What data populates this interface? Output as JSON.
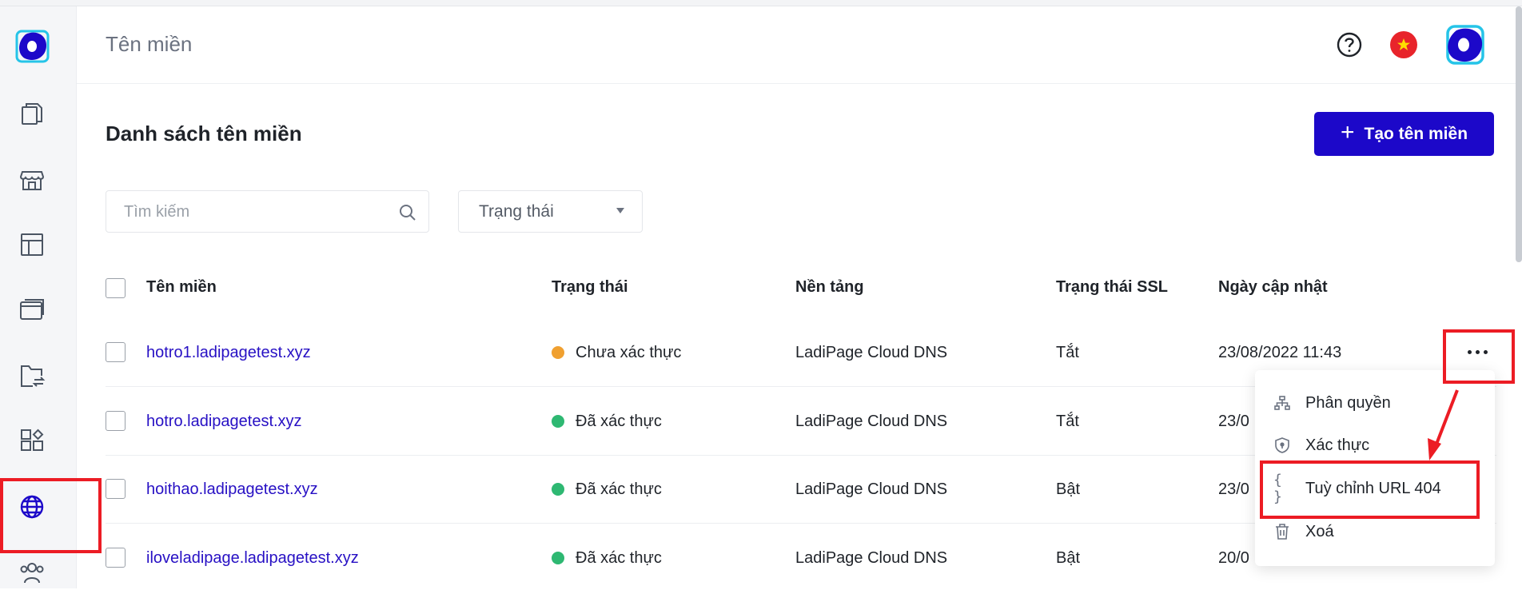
{
  "header": {
    "title": "Tên miền"
  },
  "section": {
    "title": "Danh sách tên miền",
    "create_label": "Tạo tên miền"
  },
  "filters": {
    "search_placeholder": "Tìm kiếm",
    "status_label": "Trạng thái"
  },
  "table": {
    "columns": [
      "Tên miền",
      "Trạng thái",
      "Nền tảng",
      "Trạng thái SSL",
      "Ngày cập nhật"
    ],
    "rows": [
      {
        "domain": "hotro1.ladipagetest.xyz",
        "status": "Chưa xác thực",
        "platform": "LadiPage Cloud DNS",
        "ssl": "Tắt",
        "updated": "23/08/2022 11:43"
      },
      {
        "domain": "hotro.ladipagetest.xyz",
        "status": "Đã xác thực",
        "platform": "LadiPage Cloud DNS",
        "ssl": "Tắt",
        "updated": "23/0"
      },
      {
        "domain": "hoithao.ladipagetest.xyz",
        "status": "Đã xác thực",
        "platform": "LadiPage Cloud DNS",
        "ssl": "Bật",
        "updated": "23/0"
      },
      {
        "domain": "iloveladipage.ladipagetest.xyz",
        "status": "Đã xác thực",
        "platform": "LadiPage Cloud DNS",
        "ssl": "Bật",
        "updated": "20/0"
      }
    ]
  },
  "menu": {
    "items": [
      {
        "label": "Phân quyền",
        "icon": "sitemap-icon"
      },
      {
        "label": "Xác thực",
        "icon": "shield-icon"
      },
      {
        "label": "Tuỳ chỉnh URL 404",
        "icon": "curly-braces-icon"
      },
      {
        "label": "Xoá",
        "icon": "trash-icon"
      }
    ]
  },
  "colors": {
    "brand": "#1c08c9",
    "link": "#2710c4",
    "status_pending": "#f0a030",
    "status_verified": "#2eb872",
    "annotation": "#ec1c24",
    "flag_red": "#e8242b",
    "flag_star": "#ffde00"
  },
  "icons": {
    "sidebar": [
      "pages-icon",
      "store-icon",
      "layout-template-icon",
      "browser-icon",
      "folder-transfer-icon",
      "apps-grid-icon",
      "globe-icon",
      "users-icon"
    ],
    "header": [
      "help-icon",
      "vietnam-flag-icon",
      "avatar"
    ]
  }
}
